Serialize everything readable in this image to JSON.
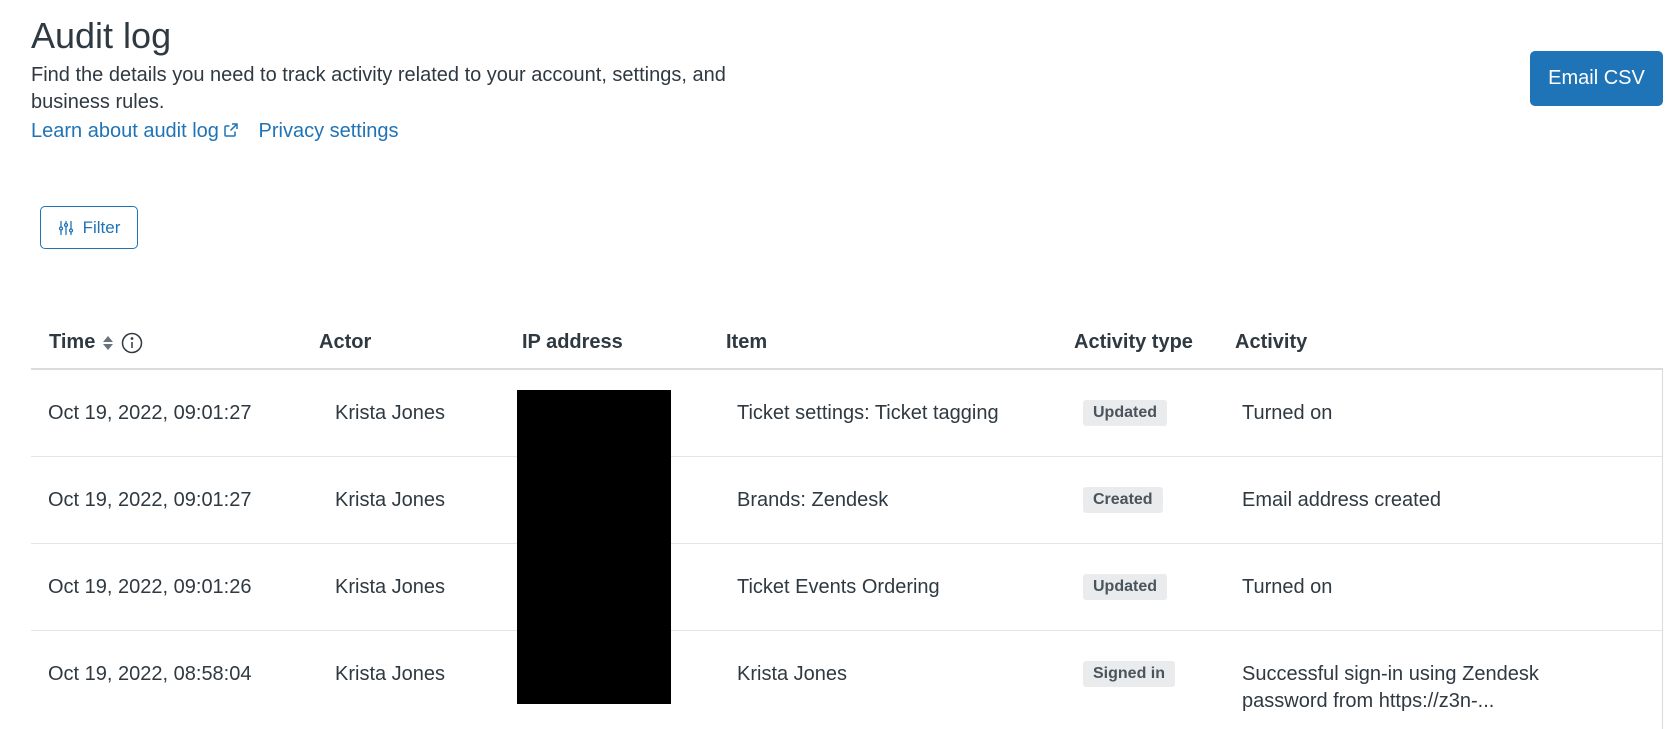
{
  "header": {
    "title": "Audit log",
    "description": "Find the details you need to track activity related to your account, settings, and business rules.",
    "learn_link": "Learn about audit log",
    "privacy_link": "Privacy settings"
  },
  "actions": {
    "email_csv": "Email CSV",
    "filter": "Filter"
  },
  "table": {
    "columns": {
      "time": "Time",
      "actor": "Actor",
      "ip": "IP address",
      "item": "Item",
      "type": "Activity type",
      "activity": "Activity"
    },
    "rows": [
      {
        "time": "Oct 19, 2022, 09:01:27",
        "actor": "Krista Jones",
        "item": "Ticket settings: Ticket tagging",
        "type": "Updated",
        "activity": "Turned on"
      },
      {
        "time": "Oct 19, 2022, 09:01:27",
        "actor": "Krista Jones",
        "item": "Brands: Zendesk",
        "type": "Created",
        "activity": "Email address created"
      },
      {
        "time": "Oct 19, 2022, 09:01:26",
        "actor": "Krista Jones",
        "item": "Ticket Events Ordering",
        "type": "Updated",
        "activity": "Turned on"
      },
      {
        "time": "Oct 19, 2022, 08:58:04",
        "actor": "Krista Jones",
        "item": "Krista Jones",
        "type": "Signed in",
        "activity": "Successful sign-in using Zendesk password from https://z3n-..."
      }
    ]
  },
  "colors": {
    "primary": "#1f73b7",
    "text": "#2f3941",
    "badge_bg": "#e9ebed",
    "border": "#d8dcde"
  },
  "icons": {
    "external_link": "external-link-icon",
    "filter": "sliders-icon",
    "sort": "sort-icon",
    "info": "info-icon"
  }
}
